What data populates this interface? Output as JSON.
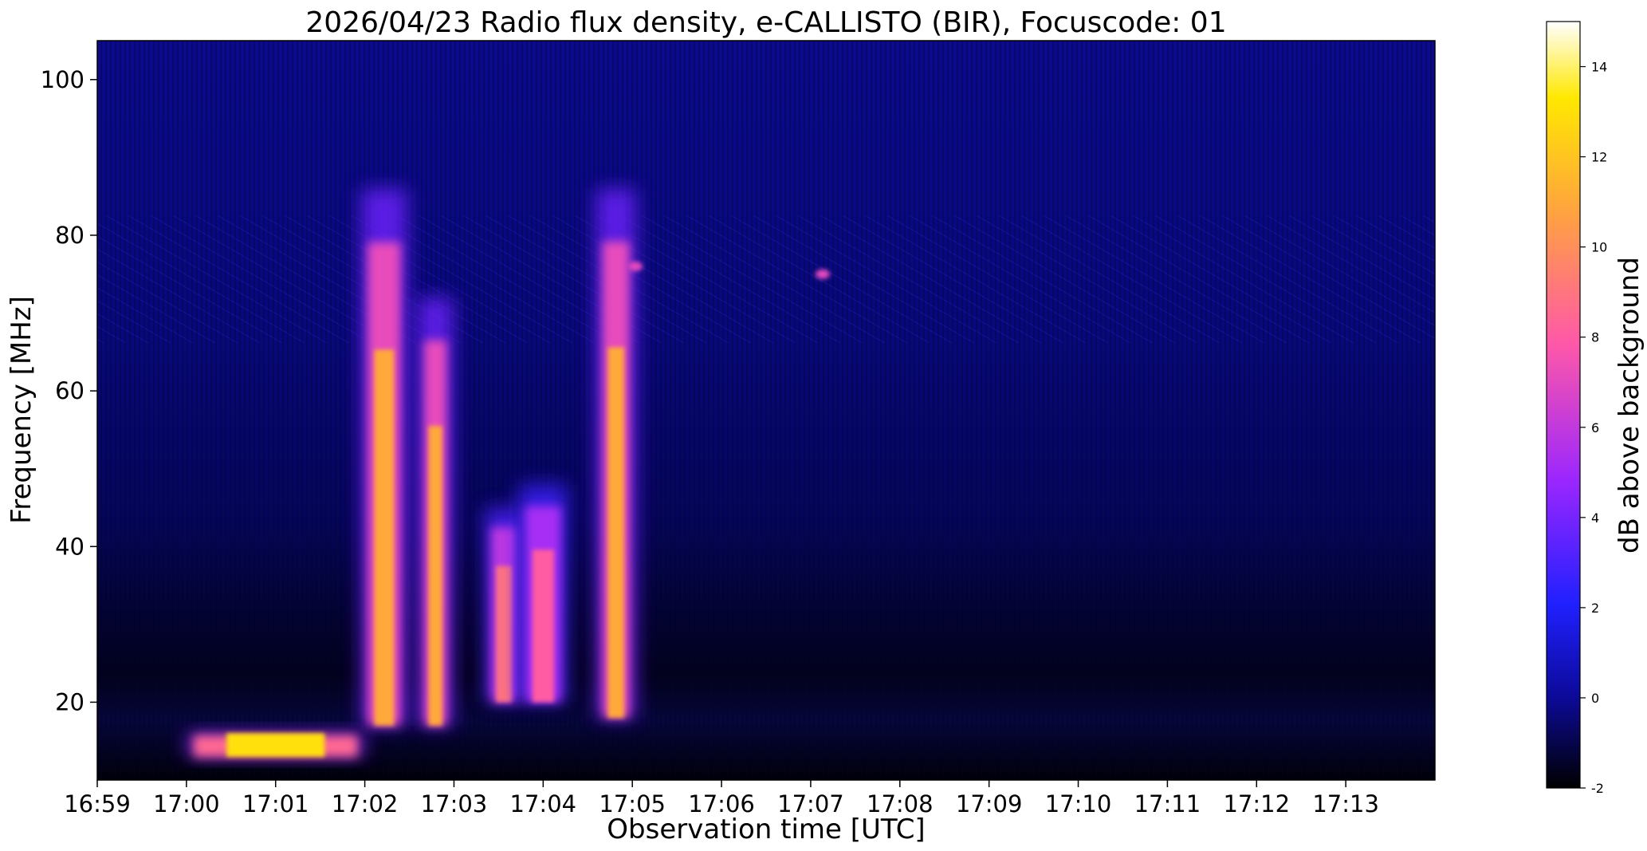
{
  "chart_data": {
    "type": "heatmap",
    "title": "2026/04/23  Radio flux density, e-CALLISTO (BIR), Focuscode: 01",
    "xlabel": "Observation time [UTC]",
    "ylabel": "Frequency [MHz]",
    "x_ticks": [
      "16:59",
      "17:00",
      "17:01",
      "17:02",
      "17:03",
      "17:04",
      "17:05",
      "17:06",
      "17:07",
      "17:08",
      "17:09",
      "17:10",
      "17:11",
      "17:12",
      "17:13"
    ],
    "x_range": [
      "16:59",
      "17:14"
    ],
    "y_ticks": [
      20,
      40,
      60,
      80,
      100
    ],
    "ylim": [
      10,
      105
    ],
    "colorbar": {
      "label": "dB above background",
      "range": [
        -2,
        15
      ],
      "ticks": [
        -2,
        0,
        2,
        4,
        6,
        8,
        10,
        12,
        14
      ],
      "colormap": "gnuplot2",
      "colors": [
        "#000000",
        "#0c0a9a",
        "#2020ff",
        "#9a26ff",
        "#ff58a8",
        "#ffa240",
        "#ffe800",
        "#ffffff"
      ]
    },
    "features": [
      {
        "kind": "burst",
        "time_start": "17:02:02",
        "time_end": "17:02:24",
        "freq_low": 17,
        "freq_high": 86,
        "peak_db": 11
      },
      {
        "kind": "burst",
        "time_start": "17:02:40",
        "time_end": "17:02:55",
        "freq_low": 17,
        "freq_high": 72,
        "peak_db": 11
      },
      {
        "kind": "burst",
        "time_start": "17:03:25",
        "time_end": "17:03:42",
        "freq_low": 20,
        "freq_high": 45,
        "peak_db": 9
      },
      {
        "kind": "burst",
        "time_start": "17:03:48",
        "time_end": "17:04:12",
        "freq_low": 20,
        "freq_high": 48,
        "peak_db": 8
      },
      {
        "kind": "burst",
        "time_start": "17:04:40",
        "time_end": "17:04:58",
        "freq_low": 18,
        "freq_high": 86,
        "peak_db": 11
      },
      {
        "kind": "band",
        "time_start": "17:00:05",
        "time_end": "17:01:55",
        "freq_low": 13,
        "freq_high": 16,
        "peak_db": 13
      },
      {
        "kind": "spot",
        "time": "17:07:08",
        "freq": 75,
        "peak_db": 7
      },
      {
        "kind": "spot",
        "time": "17:05:02",
        "freq": 76,
        "peak_db": 7
      }
    ]
  }
}
